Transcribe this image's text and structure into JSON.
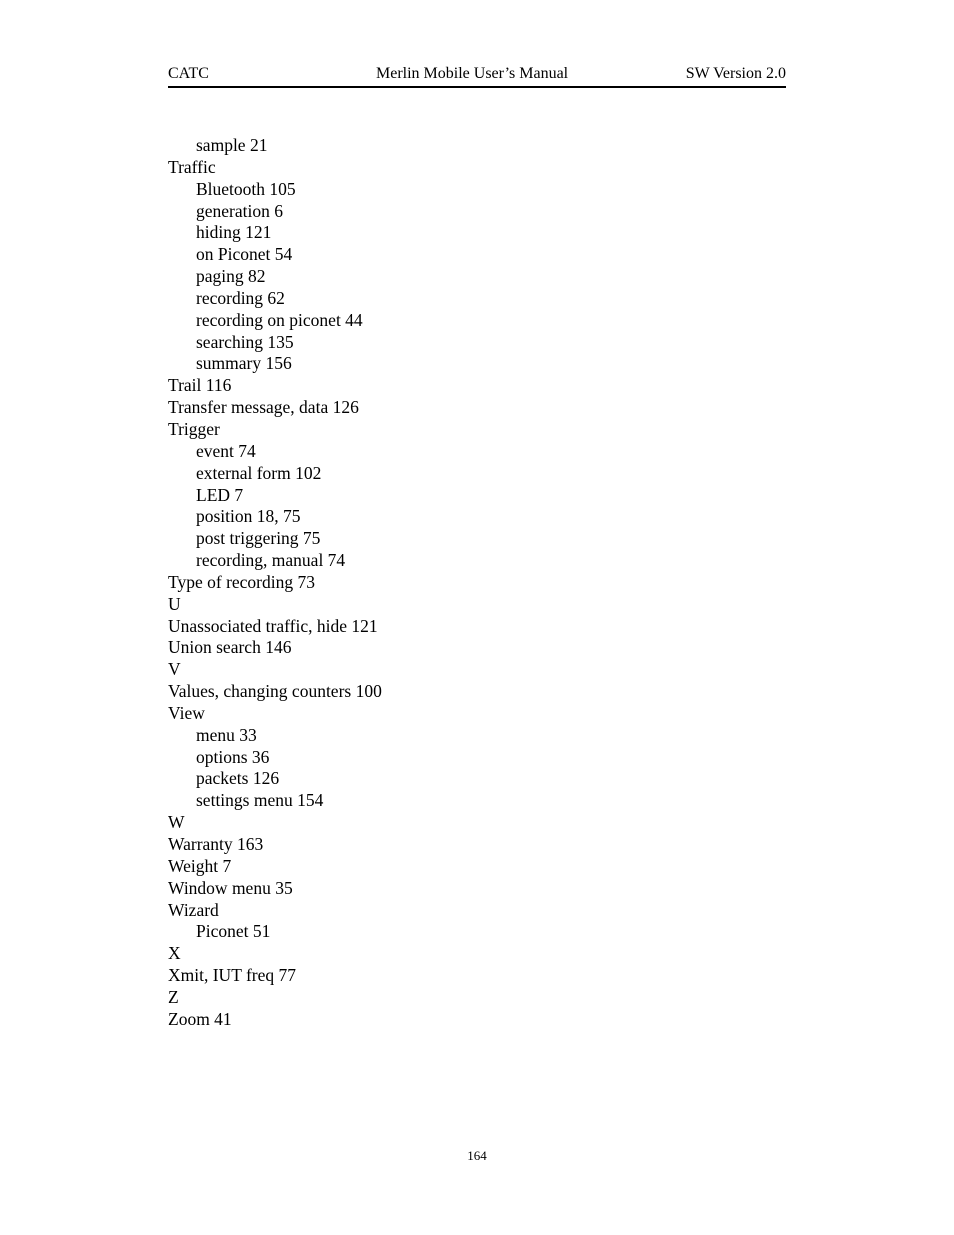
{
  "header": {
    "left": "CATC",
    "center": "Merlin Mobile User’s Manual",
    "right": "SW Version 2.0"
  },
  "index_entries": [
    {
      "text": "sample 21",
      "level": 1
    },
    {
      "text": "Traffic",
      "level": 0
    },
    {
      "text": "Bluetooth 105",
      "level": 1
    },
    {
      "text": "generation 6",
      "level": 1
    },
    {
      "text": "hiding 121",
      "level": 1
    },
    {
      "text": "on Piconet 54",
      "level": 1
    },
    {
      "text": "paging 82",
      "level": 1
    },
    {
      "text": "recording 62",
      "level": 1
    },
    {
      "text": "recording on piconet 44",
      "level": 1
    },
    {
      "text": "searching 135",
      "level": 1
    },
    {
      "text": "summary 156",
      "level": 1
    },
    {
      "text": "Trail 116",
      "level": 0
    },
    {
      "text": "Transfer message, data 126",
      "level": 0
    },
    {
      "text": "Trigger",
      "level": 0
    },
    {
      "text": "event 74",
      "level": 1
    },
    {
      "text": "external form 102",
      "level": 1
    },
    {
      "text": "LED 7",
      "level": 1
    },
    {
      "text": "position 18, 75",
      "level": 1
    },
    {
      "text": "post triggering 75",
      "level": 1
    },
    {
      "text": "recording, manual 74",
      "level": 1
    },
    {
      "text": "Type of recording 73",
      "level": 0
    },
    {
      "text": "U",
      "level": 0
    },
    {
      "text": "Unassociated traffic, hide 121",
      "level": 0
    },
    {
      "text": "Union search 146",
      "level": 0
    },
    {
      "text": "V",
      "level": 0
    },
    {
      "text": "Values, changing counters 100",
      "level": 0
    },
    {
      "text": "View",
      "level": 0
    },
    {
      "text": "menu 33",
      "level": 1
    },
    {
      "text": "options 36",
      "level": 1
    },
    {
      "text": "packets 126",
      "level": 1
    },
    {
      "text": "settings menu 154",
      "level": 1
    },
    {
      "text": "W",
      "level": 0
    },
    {
      "text": "Warranty 163",
      "level": 0
    },
    {
      "text": "Weight 7",
      "level": 0
    },
    {
      "text": "Window menu 35",
      "level": 0
    },
    {
      "text": "Wizard",
      "level": 0
    },
    {
      "text": "Piconet 51",
      "level": 1
    },
    {
      "text": "X",
      "level": 0
    },
    {
      "text": "Xmit, IUT freq 77",
      "level": 0
    },
    {
      "text": "Z",
      "level": 0
    },
    {
      "text": "Zoom 41",
      "level": 0
    }
  ],
  "footer": {
    "page_number": "164"
  }
}
